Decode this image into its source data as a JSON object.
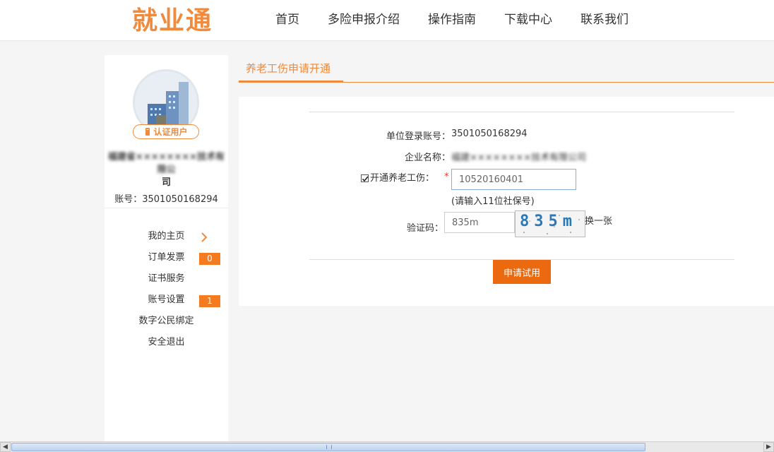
{
  "header": {
    "logo": "就业通",
    "nav": [
      "首页",
      "多险申报介绍",
      "操作指南",
      "下载中心",
      "联系我们"
    ]
  },
  "sidebar": {
    "badge": "认证用户",
    "company_name_line1": "福建省××××××××技术有限公",
    "company_name_line2": "司",
    "account_label": "账号：",
    "account": "3501050168294",
    "menu": [
      {
        "label": "我的主页"
      },
      {
        "label": "订单发票",
        "count": "0"
      },
      {
        "label": "证书服务"
      },
      {
        "label": "账号设置",
        "count": "1"
      },
      {
        "label": "数字公民绑定"
      },
      {
        "label": "安全退出"
      }
    ]
  },
  "main": {
    "tab": "养老工伤申请开通",
    "form": {
      "login_label": "单位登录账号：",
      "login_value": "3501050168294",
      "company_label": "企业名称：",
      "company_value": "福建××××××××技术有限公司",
      "pension_label": "开通养老工伤：",
      "required_mark": "*",
      "social_security_value": "10520160401",
      "hint": "(请输入11位社保号)",
      "captcha_label": "验证码：",
      "captcha_value": "835m",
      "captcha_image_text": "835m",
      "refresh": "换一张",
      "submit": "申请试用"
    }
  },
  "colors": {
    "accent": "#f08a3c",
    "button": "#ec6a0f"
  }
}
